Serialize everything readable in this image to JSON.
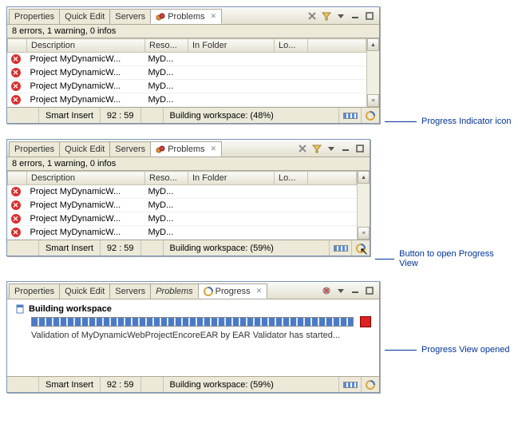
{
  "tabs": {
    "properties": "Properties",
    "quickEdit": "Quick Edit",
    "servers": "Servers",
    "problems": "Problems",
    "progress": "Progress"
  },
  "summary": "8 errors, 1 warning, 0 infos",
  "columns": {
    "desc": "Description",
    "reso": "Reso...",
    "folder": "In Folder",
    "loc": "Lo..."
  },
  "rows": [
    {
      "desc": "Project MyDynamicW...",
      "reso": "MyD..."
    },
    {
      "desc": "Project MyDynamicW...",
      "reso": "MyD..."
    },
    {
      "desc": "Project MyDynamicW...",
      "reso": "MyD..."
    },
    {
      "desc": "Project MyDynamicW...",
      "reso": "MyD..."
    }
  ],
  "status": {
    "smartInsert": "Smart Insert",
    "pos": "92 : 59",
    "building48": "Building workspace: (48%)",
    "building59": "Building workspace: (59%)"
  },
  "progressView": {
    "title": "Building workspace",
    "detail": "Validation of MyDynamicWebProjectEncoreEAR by EAR Validator has started..."
  },
  "callouts": {
    "c1": "Progress Indicator icon",
    "c2": "Button to open Progress View",
    "c3": "Progress View opened"
  }
}
